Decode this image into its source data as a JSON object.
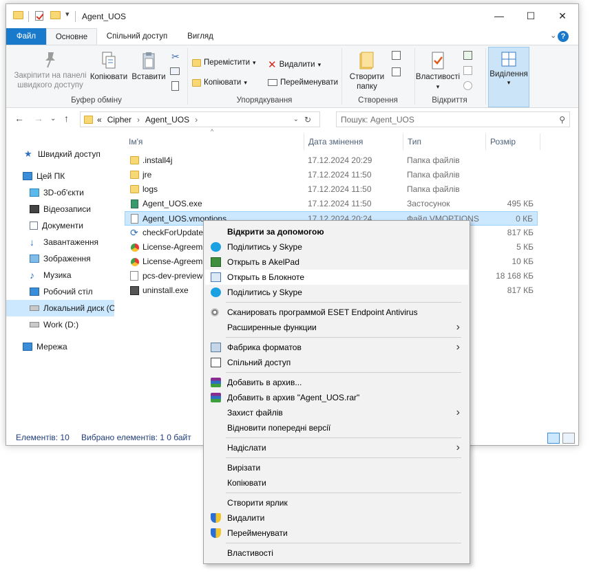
{
  "window": {
    "title": "Agent_UOS",
    "buttons": {
      "minimize": "—",
      "maximize": "☐",
      "close": "✕"
    }
  },
  "ribbon_tabs": [
    {
      "label": "Файл"
    },
    {
      "label": "Основне"
    },
    {
      "label": "Спільний доступ"
    },
    {
      "label": "Вигляд"
    }
  ],
  "ribbon": {
    "clipboard": {
      "pin": "Закріпити на панелі швидкого доступу",
      "copy": "Копіювати",
      "paste": "Вставити",
      "group": "Буфер обміну"
    },
    "organize": {
      "move_to": "Перемістити",
      "copy_to": "Копіювати",
      "delete": "Видалити",
      "rename": "Перейменувати",
      "group": "Упорядкування"
    },
    "new": {
      "new_folder": "Створити папку",
      "group": "Створення"
    },
    "open": {
      "properties": "Властивості",
      "group": "Відкриття"
    },
    "select": {
      "select": "Виділення"
    }
  },
  "address": {
    "prefix": "«",
    "crumbs": [
      "Cipher",
      "Agent_UOS"
    ],
    "search_placeholder": "Пошук: Agent_UOS"
  },
  "nav_pane": [
    {
      "label": "Швидкий доступ",
      "icon": "star-icon"
    },
    {
      "label": "Цей ПК",
      "icon": "pc-icon"
    },
    {
      "label": "3D-об'єкти",
      "icon": "cube-icon"
    },
    {
      "label": "Відеозаписи",
      "icon": "film-icon"
    },
    {
      "label": "Документи",
      "icon": "document-icon"
    },
    {
      "label": "Завантаження",
      "icon": "download-icon"
    },
    {
      "label": "Зображення",
      "icon": "pictures-icon"
    },
    {
      "label": "Музика",
      "icon": "music-icon"
    },
    {
      "label": "Робочий стіл",
      "icon": "desktop-icon"
    },
    {
      "label": "Локальний диск (C",
      "icon": "drive-icon"
    },
    {
      "label": "Work (D:)",
      "icon": "drive-icon"
    },
    {
      "label": "Мережа",
      "icon": "network-icon"
    }
  ],
  "columns": {
    "name": "Ім'я",
    "date": "Дата змінення",
    "type": "Тип",
    "size": "Розмір"
  },
  "files": [
    {
      "name": ".install4j",
      "date": "17.12.2024 20:29",
      "type": "Папка файлів",
      "size": ""
    },
    {
      "name": "jre",
      "date": "17.12.2024 11:50",
      "type": "Папка файлів",
      "size": ""
    },
    {
      "name": "logs",
      "date": "17.12.2024 11:50",
      "type": "Папка файлів",
      "size": ""
    },
    {
      "name": "Agent_UOS.exe",
      "date": "17.12.2024 11:50",
      "type": "Застосунок",
      "size": "495 КБ"
    },
    {
      "name": "Agent_UOS.vmoptions",
      "date": "17.12.2024 20:24",
      "type": "Файл VMOPTIONS",
      "size": "0 КБ"
    },
    {
      "name": "checkForUpdate.",
      "date": "",
      "type": "",
      "size": "817 КБ"
    },
    {
      "name": "License-Agreem",
      "date": "",
      "type": "",
      "size": "5 КБ"
    },
    {
      "name": "License-Agreem",
      "date": "",
      "type": "",
      "size": "10 КБ"
    },
    {
      "name": "pcs-dev-preview",
      "date": "",
      "type": "",
      "size": "18 168 КБ"
    },
    {
      "name": "uninstall.exe",
      "date": "",
      "type": "",
      "size": "817 КБ"
    }
  ],
  "status": {
    "count": "Елементів: 10",
    "selected": "Вибрано елементів: 1  0 байт"
  },
  "context_menu": [
    {
      "label": "Відкрити за допомогою"
    },
    {
      "label": "Поділитись у Skype"
    },
    {
      "label": "Открыть в AkelPad"
    },
    {
      "label": "Открыть в Блокноте"
    },
    {
      "label": "Поділитись у Skype"
    },
    {
      "label": "Сканировать программой ESET Endpoint Antivirus"
    },
    {
      "label": "Расширенные функции"
    },
    {
      "label": "Фабрика форматов"
    },
    {
      "label": "Спільний доступ"
    },
    {
      "label": "Добавить в архив..."
    },
    {
      "label": "Добавить в архив \"Agent_UOS.rar\""
    },
    {
      "label": "Захист файлів"
    },
    {
      "label": "Відновити попередні версії"
    },
    {
      "label": "Надіслати"
    },
    {
      "label": "Вирізати"
    },
    {
      "label": "Копіювати"
    },
    {
      "label": "Створити ярлик"
    },
    {
      "label": "Видалити"
    },
    {
      "label": "Перейменувати"
    },
    {
      "label": "Властивості"
    }
  ]
}
